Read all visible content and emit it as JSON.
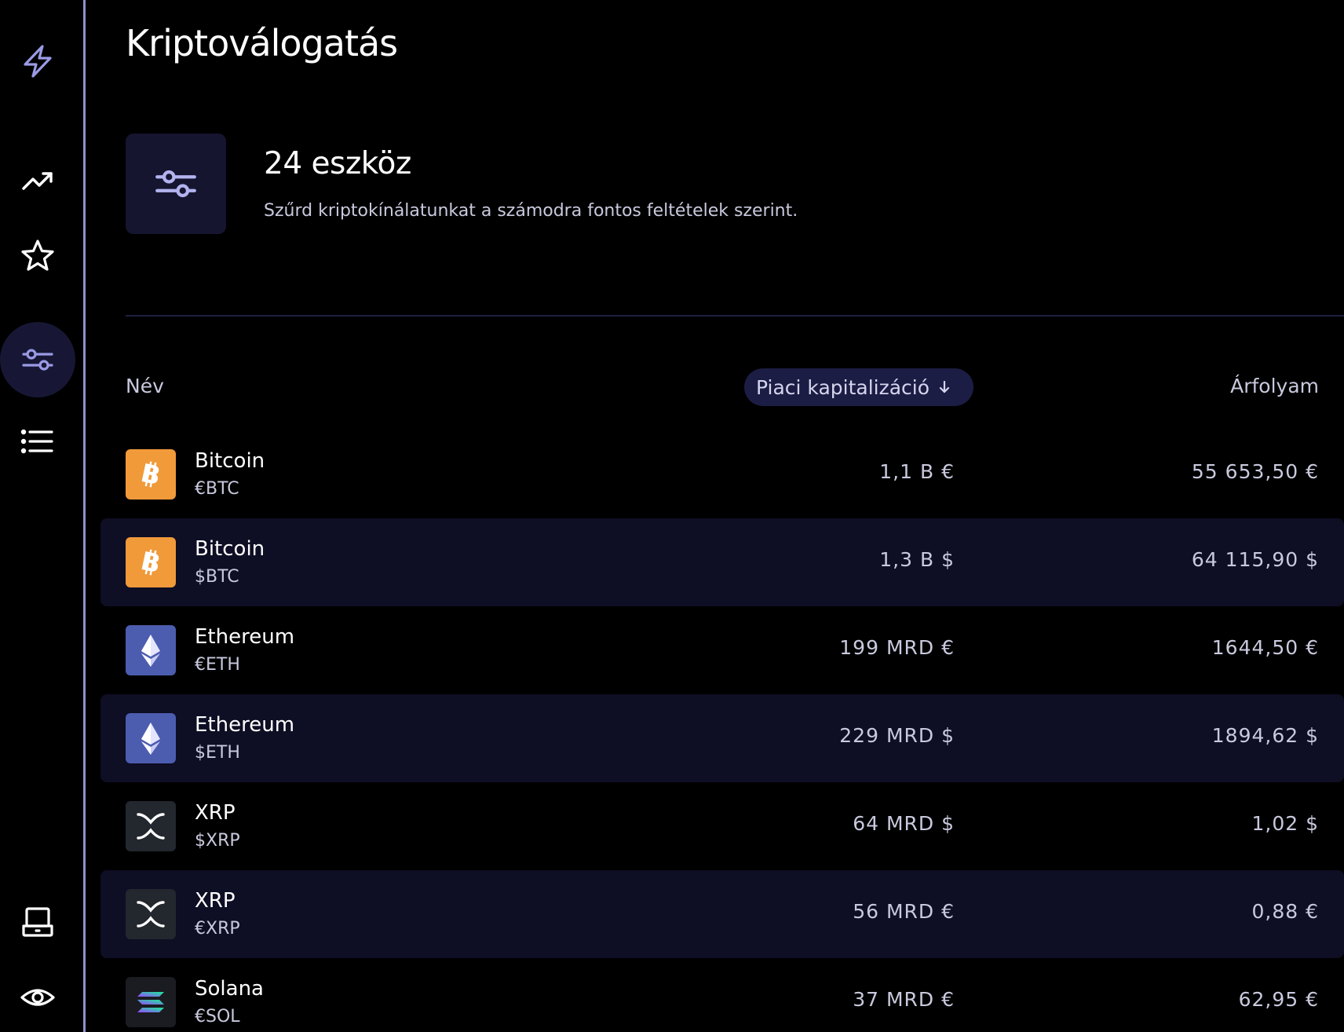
{
  "page": {
    "title": "Kriptoválogatás"
  },
  "sidebar": {
    "items": [
      {
        "name": "logo",
        "icon": "lightning-icon"
      },
      {
        "name": "trending",
        "icon": "trending-up-icon"
      },
      {
        "name": "favorites",
        "icon": "star-icon"
      },
      {
        "name": "filters",
        "icon": "sliders-icon",
        "active": true
      },
      {
        "name": "list",
        "icon": "list-icon"
      },
      {
        "name": "device",
        "icon": "laptop-icon"
      },
      {
        "name": "visibility",
        "icon": "eye-icon"
      }
    ]
  },
  "summary": {
    "count": "24 eszköz",
    "description": "Szűrd kriptokínálatunkat a számodra fontos feltételek szerint."
  },
  "table": {
    "col_name": "Név",
    "col_sort": "Piaci kapitalizáció",
    "col_price": "Árfolyam",
    "rows": [
      {
        "name": "Bitcoin",
        "ticker": "€BTC",
        "cap": "1,1 B €",
        "price": "55 653,50 €",
        "icon": "bitcoin-icon"
      },
      {
        "name": "Bitcoin",
        "ticker": "$BTC",
        "cap": "1,3 B $",
        "price": "64 115,90 $",
        "icon": "bitcoin-icon"
      },
      {
        "name": "Ethereum",
        "ticker": "€ETH",
        "cap": "199 MRD €",
        "price": "1644,50 €",
        "icon": "ethereum-icon"
      },
      {
        "name": "Ethereum",
        "ticker": "$ETH",
        "cap": "229 MRD $",
        "price": "1894,62 $",
        "icon": "ethereum-icon"
      },
      {
        "name": "XRP",
        "ticker": "$XRP",
        "cap": "64 MRD $",
        "price": "1,02 $",
        "icon": "xrp-icon"
      },
      {
        "name": "XRP",
        "ticker": "€XRP",
        "cap": "56 MRD €",
        "price": "0,88 €",
        "icon": "xrp-icon"
      },
      {
        "name": "Solana",
        "ticker": "€SOL",
        "cap": "37 MRD €",
        "price": "62,95 €",
        "icon": "solana-icon"
      }
    ]
  },
  "colors": {
    "accent": "#9a9ae6",
    "bitcoin": "#f09a3a",
    "ethereum": "#4c5db0",
    "xrp": "#23272e",
    "solana": "#1b1b22",
    "row_alt": "#0e0e24"
  }
}
